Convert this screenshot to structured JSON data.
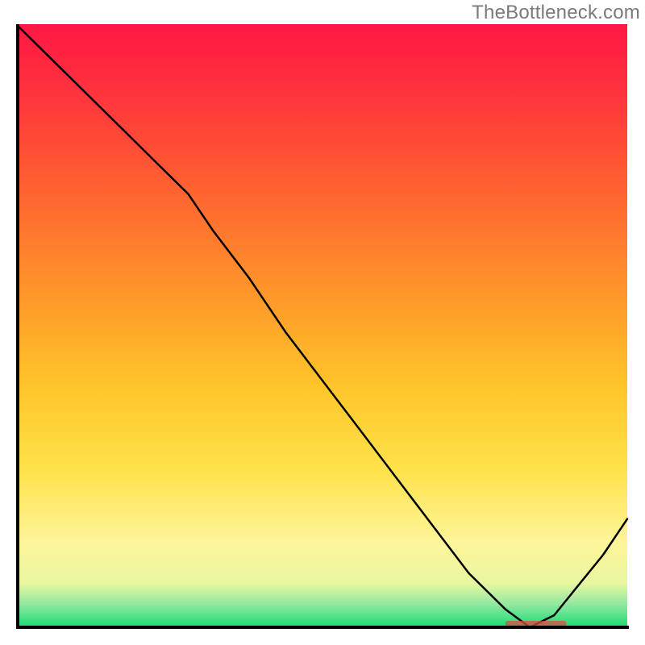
{
  "watermark": "TheBottleneck.com",
  "chart_data": {
    "type": "line",
    "title": "",
    "xlabel": "",
    "ylabel": "",
    "xlim": [
      0,
      100
    ],
    "ylim": [
      0,
      100
    ],
    "series": [
      {
        "name": "curve",
        "x": [
          0,
          6,
          12,
          18,
          24,
          28,
          32,
          38,
          44,
          50,
          56,
          62,
          68,
          74,
          80,
          84,
          88,
          92,
          96,
          100
        ],
        "y": [
          100,
          94,
          88,
          82,
          76,
          72,
          66,
          58,
          49,
          41,
          33,
          25,
          17,
          9,
          3,
          0,
          2,
          7,
          12,
          18
        ]
      }
    ],
    "optimal_range_x": [
      80,
      90
    ],
    "gradient_stops": [
      {
        "offset": 0.0,
        "color": "#ff1744"
      },
      {
        "offset": 0.14,
        "color": "#ff3a3a"
      },
      {
        "offset": 0.3,
        "color": "#ff6a2f"
      },
      {
        "offset": 0.46,
        "color": "#ff9a2a"
      },
      {
        "offset": 0.6,
        "color": "#ffc52a"
      },
      {
        "offset": 0.74,
        "color": "#ffe24a"
      },
      {
        "offset": 0.86,
        "color": "#fff59a"
      },
      {
        "offset": 0.93,
        "color": "#e8f7a0"
      },
      {
        "offset": 0.965,
        "color": "#90e8a0"
      },
      {
        "offset": 1.0,
        "color": "#22dd77"
      }
    ]
  }
}
